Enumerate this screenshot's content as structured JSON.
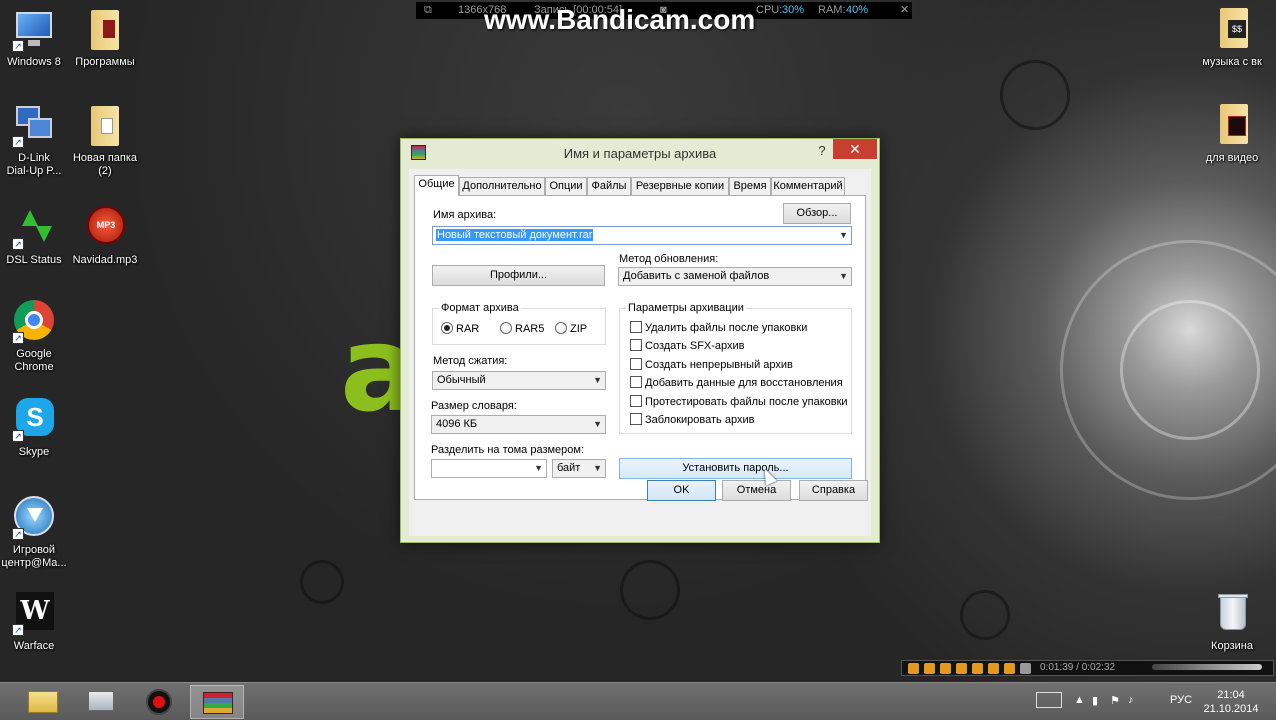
{
  "desktop": {
    "icons_left": [
      {
        "label": "Windows 8",
        "icon": "computer-icon"
      },
      {
        "label": "Программы",
        "icon": "folder-icon"
      },
      {
        "label": "D-Link\nDial-Up P...",
        "icon": "network-icon"
      },
      {
        "label": "Новая папка\n(2)",
        "icon": "folder-icon"
      },
      {
        "label": "DSL Status",
        "icon": "dsl-status-icon"
      },
      {
        "label": "Navidad.mp3",
        "icon": "mp3-icon"
      },
      {
        "label": "Google\nChrome",
        "icon": "chrome-icon"
      },
      {
        "label": "Skype",
        "icon": "skype-icon"
      },
      {
        "label": "Игровой\nцентр@Ma...",
        "icon": "game-center-icon"
      },
      {
        "label": "Warface",
        "icon": "warface-icon"
      }
    ],
    "icons_right": [
      {
        "label": "музыка с вк",
        "icon": "folder-icon"
      },
      {
        "label": "для видео",
        "icon": "folder-icon"
      },
      {
        "label": "Корзина",
        "icon": "recycle-bin-icon"
      }
    ]
  },
  "bandicam": {
    "resolution": "1366x768",
    "record": "Запись [00:00:54]",
    "cpu_label": "CPU:",
    "cpu": "30%",
    "ram_label": "RAM:",
    "ram": "40%",
    "watermark": "www.Bandicam.com"
  },
  "dialog": {
    "title": "Имя и параметры архива",
    "help": "?",
    "close": "✕",
    "tabs": [
      "Общие",
      "Дополнительно",
      "Опции",
      "Файлы",
      "Резервные копии",
      "Время",
      "Комментарий"
    ],
    "archive_name_label": "Имя архива:",
    "browse": "Обзор...",
    "archive_name_value": "Новый текстовый документ.rar",
    "profiles": "Профили...",
    "update_method_label": "Метод обновления:",
    "update_method_value": "Добавить с заменой файлов",
    "format_group": "Формат архива",
    "formats": [
      {
        "label": "RAR",
        "selected": true
      },
      {
        "label": "RAR5",
        "selected": false
      },
      {
        "label": "ZIP",
        "selected": false
      }
    ],
    "options_group": "Параметры архивации",
    "options": [
      {
        "label": "Удалить файлы после упаковки",
        "checked": false
      },
      {
        "label": "Создать SFX-архив",
        "checked": false
      },
      {
        "label": "Создать непрерывный архив",
        "checked": false
      },
      {
        "label": "Добавить данные для восстановления",
        "checked": false
      },
      {
        "label": "Протестировать файлы после упаковки",
        "checked": false
      },
      {
        "label": "Заблокировать архив",
        "checked": false
      }
    ],
    "compression_label": "Метод сжатия:",
    "compression_value": "Обычный",
    "dictionary_label": "Размер словаря:",
    "dictionary_value": "4096 КБ",
    "split_label": "Разделить на тома размером:",
    "split_value": "",
    "split_unit": "байт",
    "set_password": "Установить пароль...",
    "ok": "OK",
    "cancel": "Отмена",
    "help_btn": "Справка"
  },
  "media_player": {
    "time": "0:01:39 / 0:02:32"
  },
  "taskbar": {
    "apps": [
      "explorer-icon",
      "computer-icon",
      "record-icon",
      "winrar-icon"
    ],
    "language": "РУС",
    "time": "21:04",
    "date": "21.10.2014"
  },
  "colors": {
    "dialog_frame": "#e3ecd2",
    "close_button": "#c7402f",
    "wallpaper_accent": "#8cbf1e"
  }
}
